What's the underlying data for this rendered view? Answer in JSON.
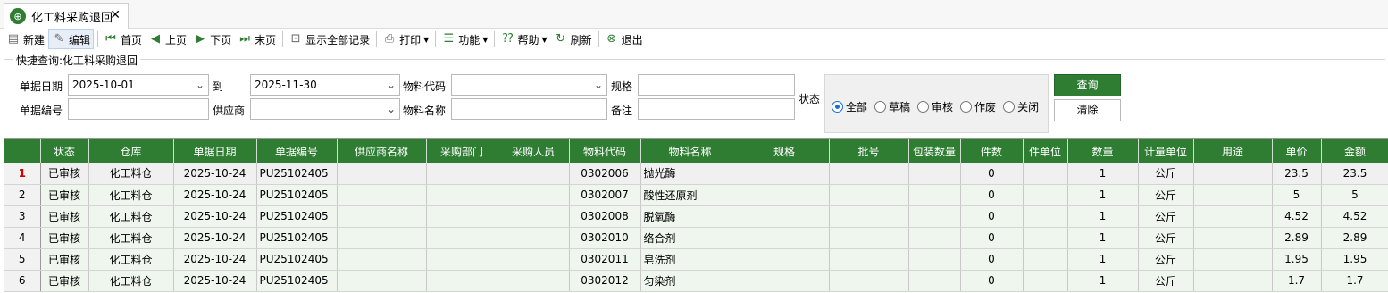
{
  "tab": {
    "title": "化工料采购退回",
    "icon": "globe-icon",
    "close": "✕"
  },
  "toolbar": {
    "new": "新建",
    "edit": "编辑",
    "first": "首页",
    "prev": "上页",
    "next": "下页",
    "last": "末页",
    "show_all": "显示全部记录",
    "print": "打印",
    "function": "功能",
    "help": "帮助",
    "refresh": "刷新",
    "exit": "退出"
  },
  "query": {
    "legend": "快捷查询:化工料采购退回",
    "date_label": "单据日期",
    "date_from": "2025-10-01",
    "to_label": "到",
    "date_to": "2025-11-30",
    "code_label": "物料代码",
    "code_value": "",
    "spec_label": "规格",
    "spec_value": "",
    "docno_label": "单据编号",
    "docno_value": "",
    "supplier_label": "供应商",
    "supplier_value": "",
    "name_label": "物料名称",
    "name_value": "",
    "remark_label": "备注",
    "remark_value": "",
    "status_label": "状态",
    "status_options": [
      "全部",
      "草稿",
      "审核",
      "作废",
      "关闭"
    ],
    "status_selected": "全部",
    "query_button": "查询",
    "clear_button": "清除"
  },
  "grid": {
    "headers": [
      "",
      "状态",
      "仓库",
      "单据日期",
      "单据编号",
      "供应商名称",
      "采购部门",
      "采购人员",
      "物料代码",
      "物料名称",
      "规格",
      "批号",
      "包装数量",
      "件数",
      "件单位",
      "数量",
      "计量单位",
      "用途",
      "单价",
      "金额"
    ],
    "rows": [
      [
        "1",
        "已审核",
        "化工料仓",
        "2025-10-24",
        "PU25102405",
        "",
        "",
        "",
        "0302006",
        "抛光酶",
        "",
        "",
        "",
        "0",
        "",
        "1",
        "公斤",
        "",
        "23.5",
        "23.5"
      ],
      [
        "2",
        "已审核",
        "化工料仓",
        "2025-10-24",
        "PU25102405",
        "",
        "",
        "",
        "0302007",
        "酸性还原剂",
        "",
        "",
        "",
        "0",
        "",
        "1",
        "公斤",
        "",
        "5",
        "5"
      ],
      [
        "3",
        "已审核",
        "化工料仓",
        "2025-10-24",
        "PU25102405",
        "",
        "",
        "",
        "0302008",
        "脱氧酶",
        "",
        "",
        "",
        "0",
        "",
        "1",
        "公斤",
        "",
        "4.52",
        "4.52"
      ],
      [
        "4",
        "已审核",
        "化工料仓",
        "2025-10-24",
        "PU25102405",
        "",
        "",
        "",
        "0302010",
        "络合剂",
        "",
        "",
        "",
        "0",
        "",
        "1",
        "公斤",
        "",
        "2.89",
        "2.89"
      ],
      [
        "5",
        "已审核",
        "化工料仓",
        "2025-10-24",
        "PU25102405",
        "",
        "",
        "",
        "0302011",
        "皂洗剂",
        "",
        "",
        "",
        "0",
        "",
        "1",
        "公斤",
        "",
        "1.95",
        "1.95"
      ],
      [
        "6",
        "已审核",
        "化工料仓",
        "2025-10-24",
        "PU25102405",
        "",
        "",
        "",
        "0302012",
        "匀染剂",
        "",
        "",
        "",
        "0",
        "",
        "1",
        "公斤",
        "",
        "1.7",
        "1.7"
      ]
    ],
    "colors": {
      "header_bg": "#2e7d32",
      "row_bg": "#eef6ee",
      "selected_rownum": "#d00000"
    }
  }
}
